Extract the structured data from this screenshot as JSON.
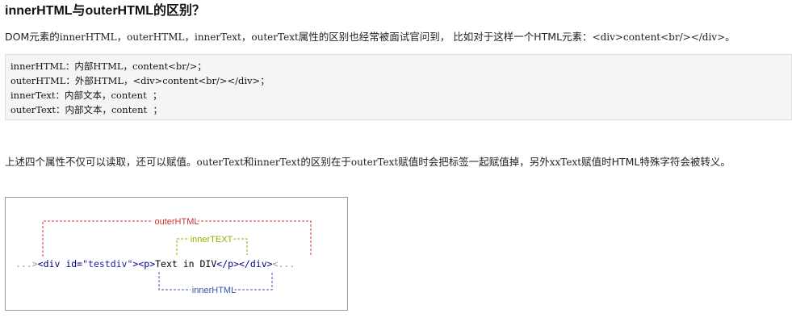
{
  "heading": "innerHTML与outerHTML的区别？",
  "intro": {
    "a": "DOM元素的",
    "b": "innerHTML",
    "c": "，",
    "d": "outerHTML",
    "e": "，",
    "f": "innerText",
    "g": "，",
    "h": "outerText",
    "i": "属性的区别也经常被面试官问到， 比如对于这样一个HTML元素：",
    "j": "<div>content<br/></div>",
    "k": "。"
  },
  "code_lines": [
    "innerHTML：内部HTML，content<br/>；",
    "outerHTML：外部HTML，<div>content<br/></div>；",
    "innerText：内部文本，content  ；",
    "outerText：内部文本，content  ；"
  ],
  "para2": {
    "a": "上述四个属性不仅可以读取，还可以赋值。",
    "b": "outerText",
    "c": "和",
    "d": "innerText",
    "e": "的区别在于",
    "f": "outerText",
    "g": "赋值时会把标签一起赋值掉，另外",
    "h": "xxText",
    "i": "赋值时HTML特殊字符会被转义。"
  },
  "diagram": {
    "label_outer_html": "outerHTML",
    "label_inner_text": "innerTEXT",
    "label_inner_html": "innerHTML",
    "code_lead": "...>",
    "code_div_open_start": "<div id=",
    "code_attr_value": "\"testdiv\"",
    "code_div_open_end": ">",
    "code_p_open": "<p>",
    "code_text": "Text in DIV",
    "code_p_close": "</p>",
    "code_div_close": "</div>",
    "code_trail": "<...",
    "colors": {
      "outer_html": "#cc3333",
      "inner_text": "#99aa00",
      "inner_html": "#3355aa",
      "code_tag": "#000088",
      "code_attr": "#1a1aa6",
      "code_text": "#000000",
      "code_faint": "#9999aa"
    }
  }
}
